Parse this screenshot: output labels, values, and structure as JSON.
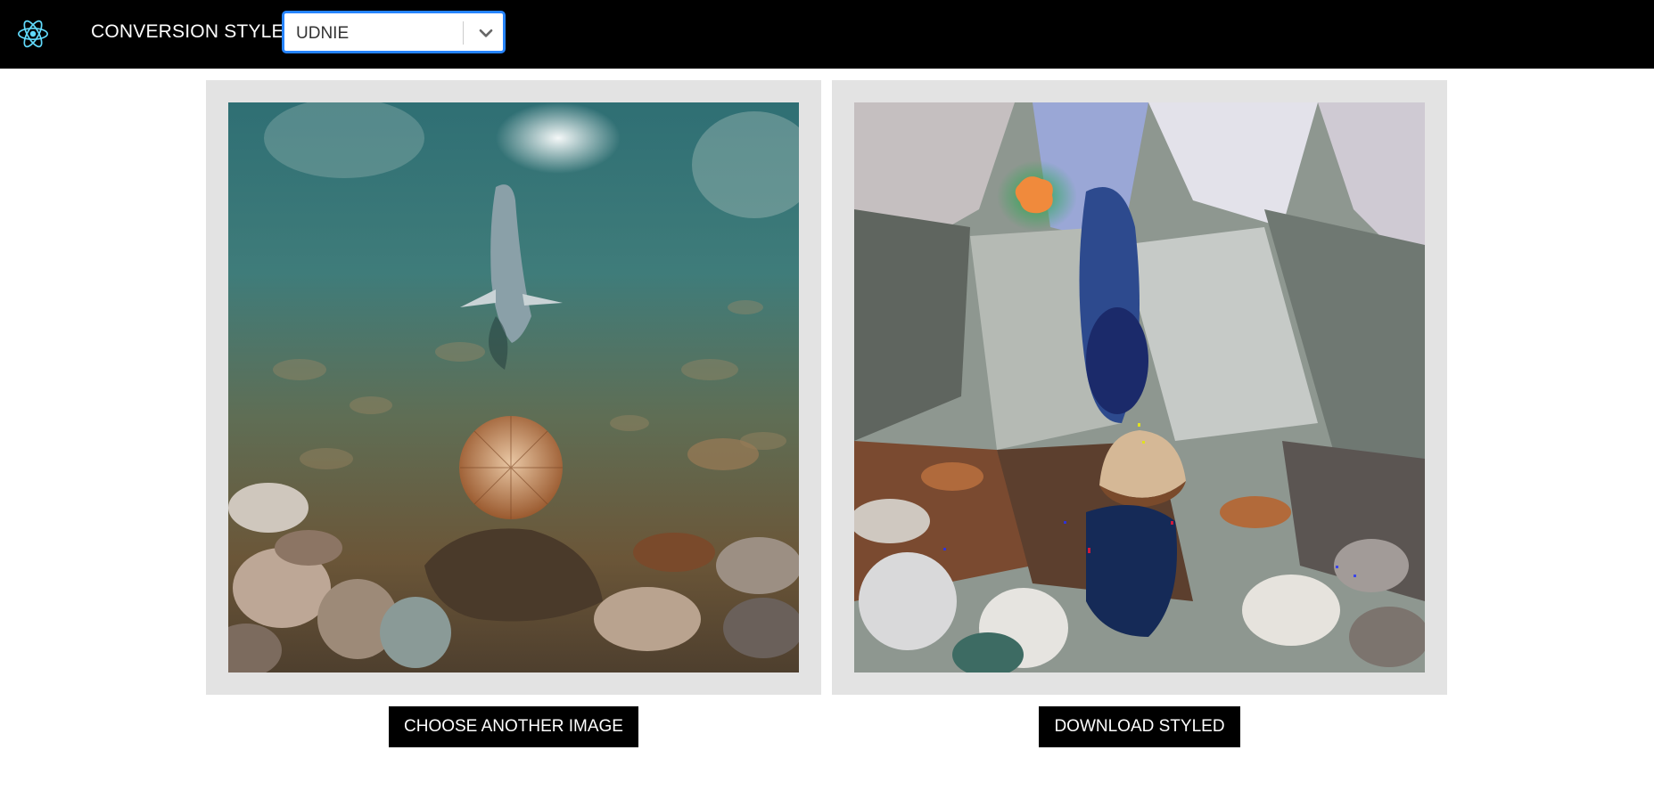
{
  "header": {
    "logo_icon": "react-atom-icon",
    "style_label": "CONVERSION STYLE:",
    "style_select": {
      "value": "UDNIE",
      "indicator_icon": "chevron-down-icon"
    }
  },
  "panels": {
    "original_image_alt": "original-image",
    "styled_image_alt": "styled-image"
  },
  "actions": {
    "choose_label": "CHOOSE ANOTHER IMAGE",
    "download_label": "DOWNLOAD STYLED"
  },
  "colors": {
    "header_bg": "#000000",
    "panel_bg": "#e3e3e3",
    "select_focus": "#2684ff",
    "logo": "#61dafb",
    "button_bg": "#000000",
    "button_text": "#ffffff"
  }
}
